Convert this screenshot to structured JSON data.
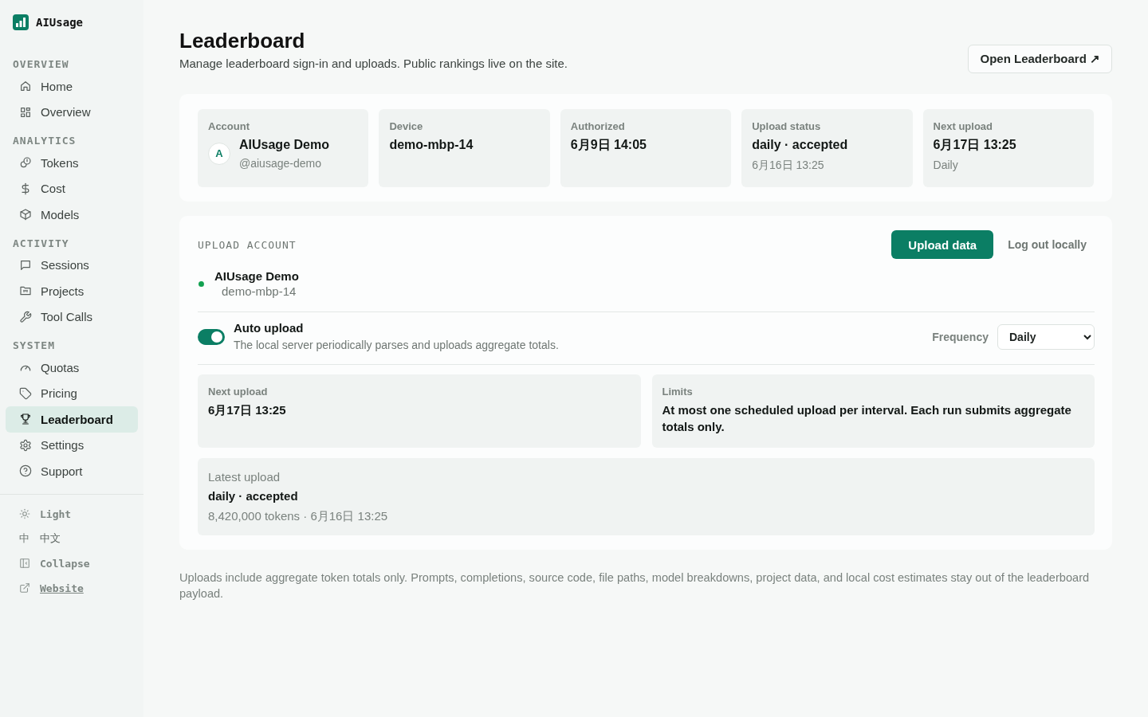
{
  "app": {
    "name": "AIUsage"
  },
  "sidebar": {
    "sections": [
      {
        "title": "OVERVIEW",
        "items": [
          {
            "label": "Home",
            "selected": false
          },
          {
            "label": "Overview",
            "selected": false
          }
        ]
      },
      {
        "title": "ANALYTICS",
        "items": [
          {
            "label": "Tokens",
            "selected": false
          },
          {
            "label": "Cost",
            "selected": false
          },
          {
            "label": "Models",
            "selected": false
          }
        ]
      },
      {
        "title": "ACTIVITY",
        "items": [
          {
            "label": "Sessions",
            "selected": false
          },
          {
            "label": "Projects",
            "selected": false
          },
          {
            "label": "Tool Calls",
            "selected": false
          }
        ]
      },
      {
        "title": "SYSTEM",
        "items": [
          {
            "label": "Quotas",
            "selected": false
          },
          {
            "label": "Pricing",
            "selected": false
          },
          {
            "label": "Leaderboard",
            "selected": true
          },
          {
            "label": "Settings",
            "selected": false
          },
          {
            "label": "Support",
            "selected": false
          }
        ]
      }
    ],
    "footer": [
      {
        "kind": "button",
        "label": "Light"
      },
      {
        "kind": "button",
        "glyph": "中",
        "label": "中文"
      },
      {
        "kind": "button",
        "label": "Collapse"
      },
      {
        "kind": "link",
        "label": "Website"
      }
    ]
  },
  "header": {
    "title": "Leaderboard",
    "subtitle": "Manage leaderboard sign-in and uploads. Public rankings live on the site.",
    "action": "Open Leaderboard ↗"
  },
  "summary": [
    {
      "kind": "account",
      "label": "Account",
      "avatar": "A",
      "value": "AIUsage Demo",
      "sub": "@aiusage-demo"
    },
    {
      "kind": "plain",
      "label": "Device",
      "value": "demo-mbp-14"
    },
    {
      "kind": "plain",
      "label": "Authorized",
      "value": "6月9日 14:05"
    },
    {
      "kind": "plain",
      "label": "Upload status",
      "value": "daily · accepted",
      "sub": "6月16日 13:25"
    },
    {
      "kind": "plain",
      "label": "Next upload",
      "value": "6月17日 13:25",
      "sub": "Daily"
    }
  ],
  "upload_account": {
    "title": "UPLOAD ACCOUNT",
    "primary_button": "Upload data",
    "secondary_button": "Log out locally",
    "account": {
      "name": "AIUsage Demo",
      "device": "demo-mbp-14",
      "connected": true
    },
    "auto_upload": {
      "label": "Auto upload",
      "description": "The local server periodically parses and uploads aggregate totals.",
      "on": true
    },
    "frequency": {
      "label": "Frequency",
      "value": "Daily"
    },
    "details": [
      {
        "label": "Next upload",
        "value": "6月17日 13:25"
      },
      {
        "label": "Limits",
        "value": "At most one scheduled upload per interval. Each run submits aggregate totals only."
      }
    ],
    "latest_upload": {
      "label": "Latest upload",
      "value": "daily · accepted",
      "sub": "8,420,000 tokens · 6月16日 13:25"
    }
  },
  "footnote": "Uploads include aggregate token totals only. Prompts, completions, source code, file paths, model breakdowns, project data, and local cost estimates stay out of the leaderboard payload."
}
